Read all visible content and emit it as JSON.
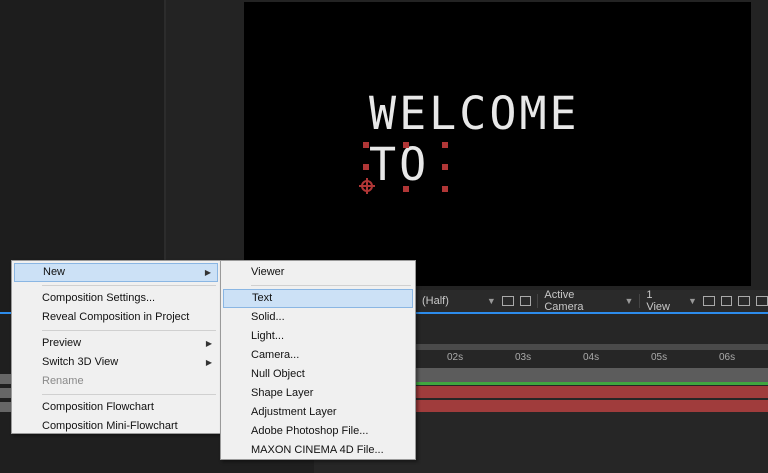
{
  "canvas": {
    "line1": "WELCOME",
    "line2": "TO"
  },
  "viewer_toolbar": {
    "resolution": "(Half)",
    "camera": "Active Camera",
    "views": "1 View"
  },
  "timeline": {
    "ruler": [
      "02s",
      "03s",
      "04s",
      "05s",
      "06s"
    ]
  },
  "context_menu": {
    "items": [
      {
        "label": "New",
        "submenu": true
      },
      {
        "label": "Composition Settings..."
      },
      {
        "label": "Reveal Composition in Project"
      },
      {
        "label": "Preview",
        "submenu": true
      },
      {
        "label": "Switch 3D View",
        "submenu": true
      },
      {
        "label": "Rename",
        "disabled": true
      },
      {
        "label": "Composition Flowchart"
      },
      {
        "label": "Composition Mini-Flowchart"
      }
    ]
  },
  "submenu": {
    "items": [
      {
        "label": "Viewer"
      },
      {
        "label": "Text"
      },
      {
        "label": "Solid..."
      },
      {
        "label": "Light..."
      },
      {
        "label": "Camera..."
      },
      {
        "label": "Null Object"
      },
      {
        "label": "Shape Layer"
      },
      {
        "label": "Adjustment Layer"
      },
      {
        "label": "Adobe Photoshop File..."
      },
      {
        "label": "MAXON CINEMA 4D File..."
      }
    ]
  },
  "colors": {
    "accent_blue": "#2d8ceb",
    "selection_handles": "#b03636",
    "track_red": "#a03c3c",
    "track_green": "#3fa63f"
  }
}
